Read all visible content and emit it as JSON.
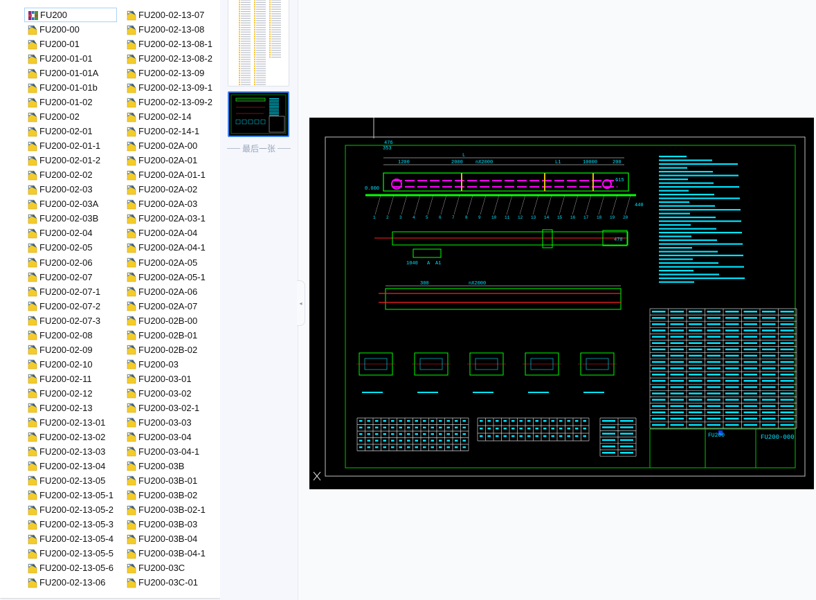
{
  "file_list": {
    "selected_index": 0,
    "columns": [
      [
        "FU200",
        "FU200-00",
        "FU200-01",
        "FU200-01-01",
        "FU200-01-01A",
        "FU200-01-01b",
        "FU200-01-02",
        "FU200-02",
        "FU200-02-01",
        "FU200-02-01-1",
        "FU200-02-01-2",
        "FU200-02-02",
        "FU200-02-03",
        "FU200-02-03A",
        "FU200-02-03B",
        "FU200-02-04",
        "FU200-02-05",
        "FU200-02-06",
        "FU200-02-07",
        "FU200-02-07-1",
        "FU200-02-07-2",
        "FU200-02-07-3",
        "FU200-02-08",
        "FU200-02-09",
        "FU200-02-10",
        "FU200-02-11",
        "FU200-02-12",
        "FU200-02-13",
        "FU200-02-13-01",
        "FU200-02-13-02",
        "FU200-02-13-03",
        "FU200-02-13-04",
        "FU200-02-13-05",
        "FU200-02-13-05-1",
        "FU200-02-13-05-2",
        "FU200-02-13-05-3",
        "FU200-02-13-05-4",
        "FU200-02-13-05-5",
        "FU200-02-13-05-6",
        "FU200-02-13-06"
      ],
      [
        "FU200-02-13-07",
        "FU200-02-13-08",
        "FU200-02-13-08-1",
        "FU200-02-13-08-2",
        "FU200-02-13-09",
        "FU200-02-13-09-1",
        "FU200-02-13-09-2",
        "FU200-02-14",
        "FU200-02-14-1",
        "FU200-02A-00",
        "FU200-02A-01",
        "FU200-02A-01-1",
        "FU200-02A-02",
        "FU200-02A-03",
        "FU200-02A-03-1",
        "FU200-02A-04",
        "FU200-02A-04-1",
        "FU200-02A-05",
        "FU200-02A-05-1",
        "FU200-02A-06",
        "FU200-02A-07",
        "FU200-02B-00",
        "FU200-02B-01",
        "FU200-02B-02",
        "FU200-03",
        "FU200-03-01",
        "FU200-03-02",
        "FU200-03-02-1",
        "FU200-03-03",
        "FU200-03-04",
        "FU200-03-04-1",
        "FU200-03B",
        "FU200-03B-01",
        "FU200-03B-02",
        "FU200-03B-02-1",
        "FU200-03B-03",
        "FU200-03B-04",
        "FU200-03B-04-1",
        "FU200-03C",
        "FU200-03C-01"
      ]
    ],
    "first_icon": "archive-icon",
    "item_icon": "dwg-file-icon"
  },
  "thumbnails": {
    "last_caption": "最后一张",
    "active_index": 1,
    "accent": "#3c7ff0"
  },
  "viewer": {
    "collapse_icon": "chevron-left-icon",
    "drawing": {
      "drawing_number": "FU200-000",
      "title_prefix": "FU200",
      "dims": [
        "L",
        "1200",
        "2000",
        "nX2000",
        "L1",
        "10000",
        "200",
        "0.000",
        "440",
        "615",
        "476",
        "353",
        "1040",
        "A",
        "A1",
        "300",
        "470"
      ],
      "colors": {
        "frame": "#00c800",
        "dim": "#ffffff",
        "text": "#00e5ff",
        "chain": "#ff00ff",
        "centerline": "#ff2020",
        "body": "#00ff00"
      }
    }
  }
}
